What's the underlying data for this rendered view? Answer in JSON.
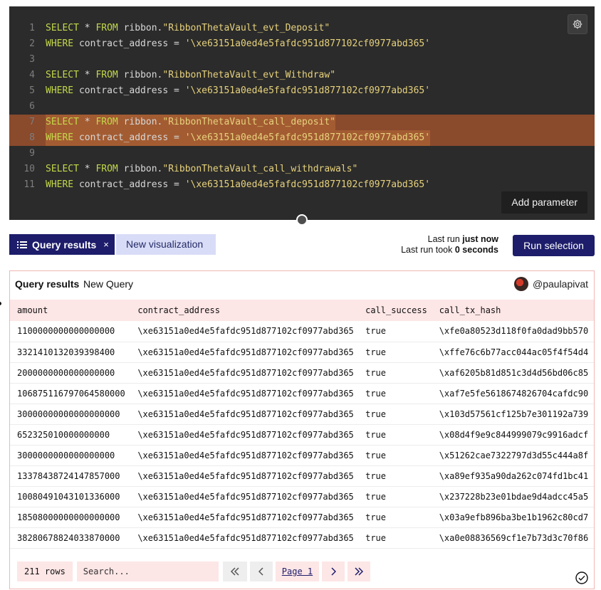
{
  "editor": {
    "lines": [
      {
        "n": "1",
        "kw1": "SELECT",
        "mid": " * ",
        "kw2": "FROM",
        "ident": " ribbon.",
        "str": "\"RibbonThetaVault_evt_Deposit\"",
        "highlight": false
      },
      {
        "n": "2",
        "kw1": "WHERE",
        "mid": " contract_address = ",
        "kw2": "",
        "ident": "",
        "str": "'\\xe63151a0ed4e5fafdc951d877102cf0977abd365'",
        "highlight": false
      },
      {
        "n": "3",
        "kw1": "",
        "mid": "",
        "kw2": "",
        "ident": "",
        "str": "",
        "highlight": false
      },
      {
        "n": "4",
        "kw1": "SELECT",
        "mid": " * ",
        "kw2": "FROM",
        "ident": " ribbon.",
        "str": "\"RibbonThetaVault_evt_Withdraw\"",
        "highlight": false
      },
      {
        "n": "5",
        "kw1": "WHERE",
        "mid": " contract_address = ",
        "kw2": "",
        "ident": "",
        "str": "'\\xe63151a0ed4e5fafdc951d877102cf0977abd365'",
        "highlight": false
      },
      {
        "n": "6",
        "kw1": "",
        "mid": "",
        "kw2": "",
        "ident": "",
        "str": "",
        "highlight": false
      },
      {
        "n": "7",
        "kw1": "SELECT",
        "mid": " * ",
        "kw2": "FROM",
        "ident": " ribbon.",
        "str": "\"RibbonThetaVault_call_deposit\"",
        "highlight": true
      },
      {
        "n": "8",
        "kw1": "WHERE",
        "mid": " contract_address = ",
        "kw2": "",
        "ident": "",
        "str": "'\\xe63151a0ed4e5fafdc951d877102cf0977abd365'",
        "highlight": true
      },
      {
        "n": "9",
        "kw1": "",
        "mid": "",
        "kw2": "",
        "ident": "",
        "str": "",
        "highlight": false
      },
      {
        "n": "10",
        "kw1": "SELECT",
        "mid": " * ",
        "kw2": "FROM",
        "ident": " ribbon.",
        "str": "\"RibbonThetaVault_call_withdrawals\"",
        "highlight": false
      },
      {
        "n": "11",
        "kw1": "WHERE",
        "mid": " contract_address = ",
        "kw2": "",
        "ident": "",
        "str": "'\\xe63151a0ed4e5fafdc951d877102cf0977abd365'",
        "highlight": false
      }
    ],
    "add_parameter_label": "Add parameter"
  },
  "toolbar": {
    "tab_active_label": "Query results",
    "tab_close": "×",
    "tab_new_label": "New visualization",
    "last_run_label": "Last run",
    "last_run_value": "just now",
    "last_took_label": "Last run took",
    "last_took_value": "0 seconds",
    "run_label": "Run selection"
  },
  "results": {
    "title": "Query results",
    "query_name": "New Query",
    "user": "@paulapivat",
    "columns": [
      "amount",
      "contract_address",
      "call_success",
      "call_tx_hash"
    ],
    "rows": [
      [
        "1100000000000000000",
        "\\xe63151a0ed4e5fafdc951d877102cf0977abd365",
        "true",
        "\\xfe0a80523d118f0fa0dad9bb570"
      ],
      [
        "3321410132039398400",
        "\\xe63151a0ed4e5fafdc951d877102cf0977abd365",
        "true",
        "\\xffe76c6b77acc044ac05f4f54d4"
      ],
      [
        "2000000000000000000",
        "\\xe63151a0ed4e5fafdc951d877102cf0977abd365",
        "true",
        "\\xaf6205b81d851c3d4d56bd06c85"
      ],
      [
        "106875116797064580000",
        "\\xe63151a0ed4e5fafdc951d877102cf0977abd365",
        "true",
        "\\xaf7e5fe5618674826704cafdc90"
      ],
      [
        "30000000000000000000",
        "\\xe63151a0ed4e5fafdc951d877102cf0977abd365",
        "true",
        "\\x103d57561cf125b7e301192a739"
      ],
      [
        "652325010000000000",
        "\\xe63151a0ed4e5fafdc951d877102cf0977abd365",
        "true",
        "\\x08d4f9e9c844999079c9916adcf"
      ],
      [
        "3000000000000000000",
        "\\xe63151a0ed4e5fafdc951d877102cf0977abd365",
        "true",
        "\\x51262cae7322797d3d55c444a8f"
      ],
      [
        "13378438724147857000",
        "\\xe63151a0ed4e5fafdc951d877102cf0977abd365",
        "true",
        "\\xa89ef935a90da262c074fd1bc41"
      ],
      [
        "10080491043101336000",
        "\\xe63151a0ed4e5fafdc951d877102cf0977abd365",
        "true",
        "\\x237228b23e01bdae9d4adcc45a5"
      ],
      [
        "18508000000000000000",
        "\\xe63151a0ed4e5fafdc951d877102cf0977abd365",
        "true",
        "\\x03a9efb896ba3be1b1962c80cd7"
      ],
      [
        "38280678824033870000",
        "\\xe63151a0ed4e5fafdc951d877102cf0977abd365",
        "true",
        "\\xa0e08836569cf1e7b73d3c70f86"
      ]
    ],
    "row_count": "211 rows",
    "search_placeholder": "Search...",
    "page_label": "Page 1"
  },
  "icons": {
    "settings": "gear-icon",
    "list": "list-icon",
    "first": "double-chevron-left-icon",
    "prev": "chevron-left-icon",
    "next": "chevron-right-icon",
    "last": "double-chevron-right-icon",
    "status": "check-circle-icon"
  },
  "colors": {
    "accent": "#1d1d6b",
    "editor_bg": "#2b2b2b",
    "selection": "#8a4a2c",
    "table_header": "#fde6e6"
  }
}
